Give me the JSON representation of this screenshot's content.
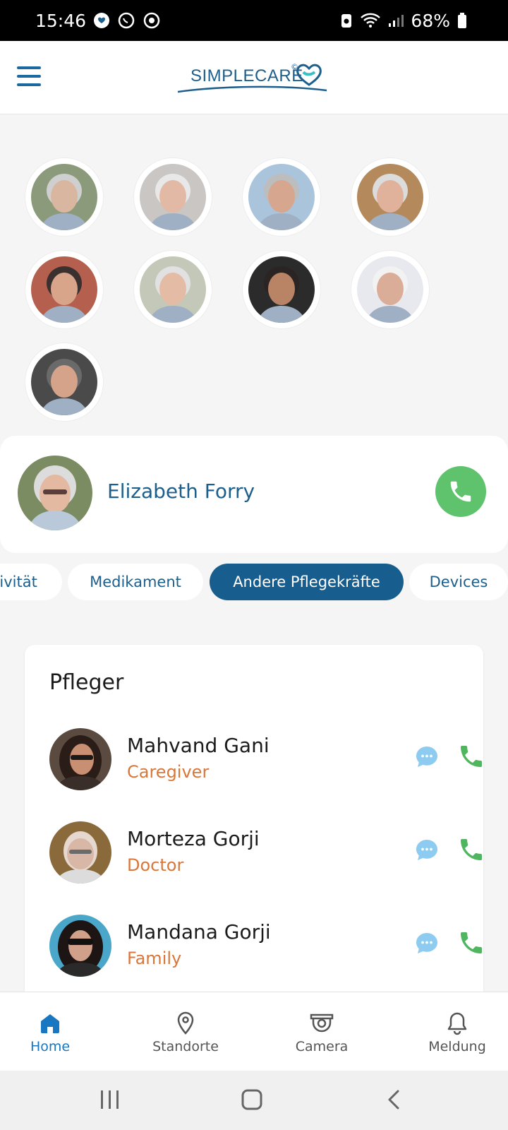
{
  "status_bar": {
    "time": "15:46",
    "battery": "68%"
  },
  "header": {
    "logo_text": "SIMPLECARE",
    "logo_mark": "©"
  },
  "avatars": [
    {
      "name": "avatar-1",
      "skin": "#d9b6a0",
      "bg": "#8b9a7a",
      "hair": "#cfcfcf"
    },
    {
      "name": "avatar-2",
      "skin": "#e2b9a4",
      "bg": "#c9c6c3",
      "hair": "#e8e8e8"
    },
    {
      "name": "avatar-3",
      "skin": "#d6a68f",
      "bg": "#aac4dc",
      "hair": "#bdbdbd"
    },
    {
      "name": "avatar-4",
      "skin": "#e0b29c",
      "bg": "#b48a5c",
      "hair": "#dcdcdc"
    },
    {
      "name": "avatar-5",
      "skin": "#d8a58a",
      "bg": "#b5604f",
      "hair": "#3b3030"
    },
    {
      "name": "avatar-6",
      "skin": "#e4bca6",
      "bg": "#c4c8b8",
      "hair": "#e1e1e1"
    },
    {
      "name": "avatar-7",
      "skin": "#b98466",
      "bg": "#2b2b2b",
      "hair": "#2a2523"
    },
    {
      "name": "avatar-8",
      "skin": "#d9ad97",
      "bg": "#e7e9ee",
      "hair": "#f2f2f2"
    },
    {
      "name": "avatar-9",
      "skin": "#d4a389",
      "bg": "#4a4a4a",
      "hair": "#6a6a6a"
    }
  ],
  "selected_person": {
    "name": "Elizabeth Forry"
  },
  "tabs": [
    {
      "label": "tivität"
    },
    {
      "label": "Medikament"
    },
    {
      "label": "Andere Pflegekräfte",
      "active": true
    },
    {
      "label": "Devices"
    }
  ],
  "caregivers": {
    "title": "Pfleger",
    "items": [
      {
        "name": "Mahvand Gani",
        "role": "Caregiver"
      },
      {
        "name": "Morteza Gorji",
        "role": "Doctor"
      },
      {
        "name": "Mandana Gorji",
        "role": "Family"
      }
    ]
  },
  "bottom_nav": [
    {
      "label": "Home",
      "icon": "home-icon",
      "active": true
    },
    {
      "label": "Standorte",
      "icon": "location-pin-icon"
    },
    {
      "label": "Camera",
      "icon": "camera-icon"
    },
    {
      "label": "Meldung",
      "icon": "bell-icon"
    }
  ],
  "colors": {
    "primary": "#175d8e",
    "call_green": "#5ec36c",
    "role_orange": "#d9773a",
    "chat_blue": "#8ecbf0"
  }
}
